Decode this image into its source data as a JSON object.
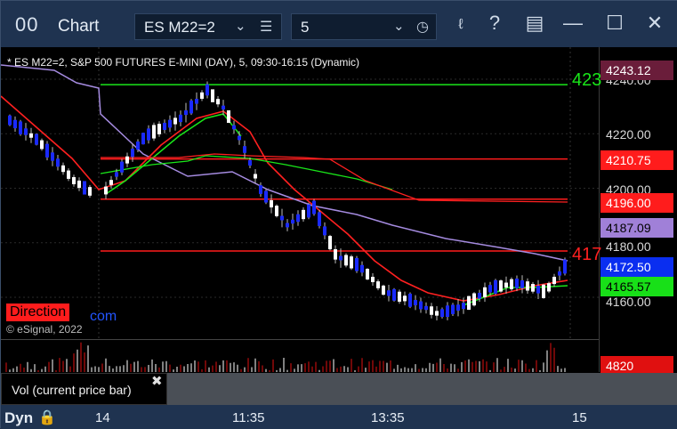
{
  "titlebar": {
    "logo": "00",
    "title": "Chart",
    "symbol": "ES M22=2",
    "interval": "5"
  },
  "chart": {
    "description": "* ES M22=2, S&P 500 FUTURES E-MINI (DAY), 5, 09:30-16:15 (Dynamic)",
    "y_ticks": [
      "4240.00",
      "4220.00",
      "4200.00",
      "4180.00",
      "4160.00"
    ],
    "price_tags": [
      {
        "label": "4243.12",
        "bg": "#6a1d3a",
        "fg": "#ffffff"
      },
      {
        "label": "4210.75",
        "bg": "#ff1c1c",
        "fg": "#ffffff"
      },
      {
        "label": "4196.00",
        "bg": "#ff1c1c",
        "fg": "#ffffff"
      },
      {
        "label": "4187.09",
        "bg": "#a080d8",
        "fg": "#000000"
      },
      {
        "label": "4172.50",
        "bg": "#0a2ef0",
        "fg": "#ffffff"
      },
      {
        "label": "4165.57",
        "bg": "#18e018",
        "fg": "#000000"
      }
    ],
    "line_labels": [
      {
        "label": "423",
        "color": "#19e619"
      },
      {
        "label": "417",
        "color": "#ff2020"
      }
    ],
    "direction": "Direction",
    "com_text": "com",
    "copyright": "© eSignal, 2022"
  },
  "volume": {
    "label": "Vol (current price bar)",
    "close": "✖",
    "tag": "4820",
    "tag_bg": "#e01010"
  },
  "bottombar": {
    "mode": "Dyn",
    "x_ticks": [
      "14",
      "11:35",
      "13:35",
      "15"
    ]
  },
  "chart_data": {
    "type": "candlestick",
    "title": "* ES M22=2, S&P 500 FUTURES E-MINI (DAY), 5, 09:30-16:15 (Dynamic)",
    "ylim": [
      4150,
      4245
    ],
    "horizontal_levels": [
      {
        "value": 4238,
        "color": "#19e619"
      },
      {
        "value": 4210.75,
        "color": "#ff1c1c"
      },
      {
        "value": 4196.0,
        "color": "#ff1c1c"
      },
      {
        "value": 4177,
        "color": "#ff1c1c"
      }
    ],
    "last_price": 4172.5
  }
}
